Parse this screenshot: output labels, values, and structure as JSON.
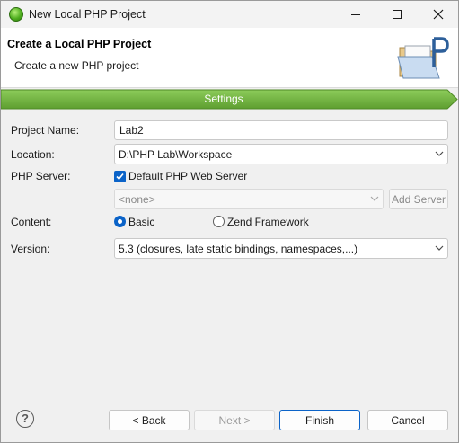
{
  "window": {
    "title": "New Local PHP Project",
    "app_icon": "green-sphere-icon"
  },
  "header": {
    "title": "Create a Local PHP Project",
    "description": "Create a new PHP project",
    "icon": "php-folder-wizard-icon"
  },
  "banner": {
    "label": "Settings",
    "color": "#6db33f"
  },
  "form": {
    "project_name": {
      "label": "Project Name:",
      "value": "Lab2"
    },
    "location": {
      "label": "Location:",
      "value": "D:\\PHP Lab\\Workspace"
    },
    "php_server": {
      "label": "PHP Server:",
      "checkbox_label": "Default PHP Web Server",
      "checked": true,
      "server_select": "<none>",
      "add_server_label": "Add Server"
    },
    "content": {
      "label": "Content:",
      "options": [
        {
          "label": "Basic",
          "selected": true
        },
        {
          "label": "Zend Framework",
          "selected": false
        }
      ]
    },
    "version": {
      "label": "Version:",
      "value": "5.3 (closures, late static bindings, namespaces,...)"
    }
  },
  "footer": {
    "help_label": "?",
    "back_label": "< Back",
    "next_label": "Next >",
    "finish_label": "Finish",
    "cancel_label": "Cancel"
  },
  "colors": {
    "accent": "#0b63c8",
    "banner_green": "#6db33f"
  }
}
